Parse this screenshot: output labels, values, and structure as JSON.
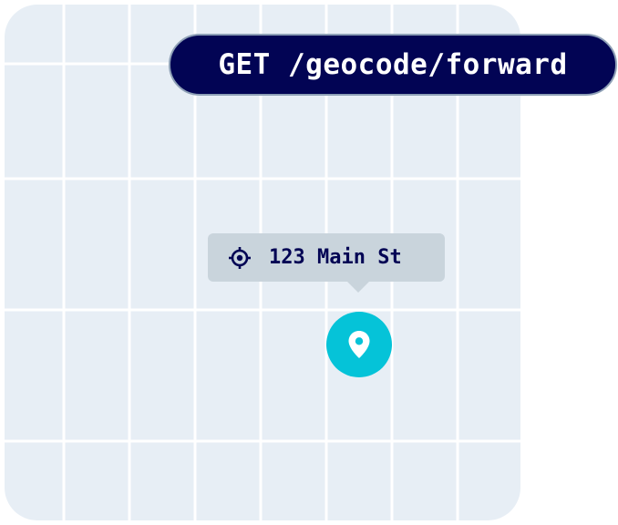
{
  "endpoint": {
    "label": "GET /geocode/forward"
  },
  "tooltip": {
    "address": "123 Main St"
  },
  "icons": {
    "tooltip_icon": "crosshair-target-icon",
    "pin_icon": "map-pin-icon"
  },
  "colors": {
    "map_background": "#e7eef5",
    "grid_lines": "#ffffff",
    "endpoint_background": "#020454",
    "endpoint_border": "#8ea0b6",
    "tooltip_background": "#c9d4dc",
    "pin_accent": "#05c3d8"
  }
}
